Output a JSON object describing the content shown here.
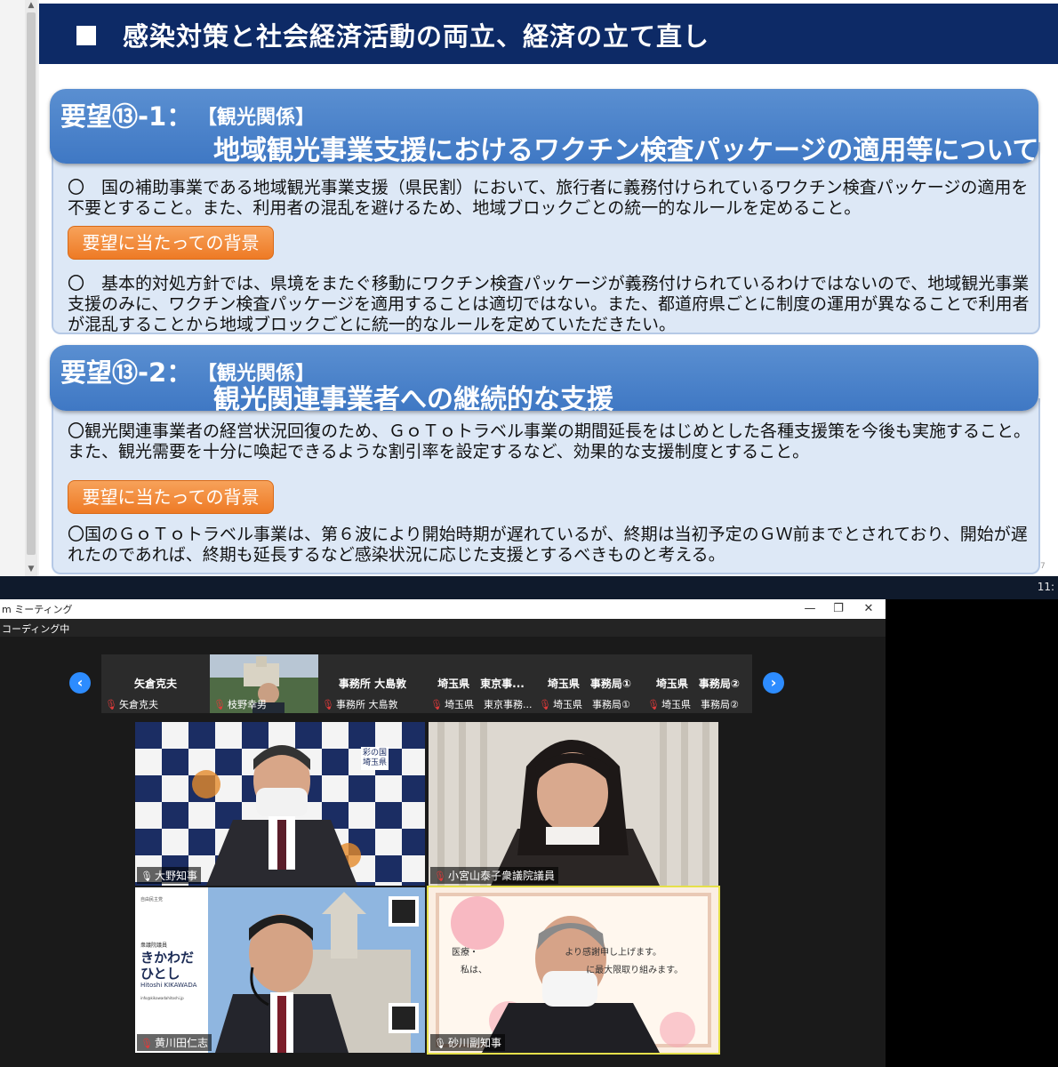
{
  "slide": {
    "header_title": "感染対策と社会経済活動の両立、経済の立て直し",
    "request1": {
      "number": "要望⑬-1：",
      "category": "【観光関係】",
      "title": "地域観光事業支援におけるワクチン検査パッケージの適用等について",
      "body_line1": "〇　国の補助事業である地域観光事業支援（県民割）において、旅行者に義務付けられているワクチン検査パッケージの適用を",
      "body_line2": "不要とすること。また、利用者の混乱を避けるため、地域ブロックごとの統一的なルールを定めること。",
      "background_button": "要望に当たっての背景",
      "bg_line1": "〇　基本的対処方針では、県境をまたぐ移動にワクチン検査パッケージが義務付けられているわけではないので、地域観光事業",
      "bg_line2": "支援のみに、ワクチン検査パッケージを適用することは適切ではない。また、都道府県ごとに制度の運用が異なることで利用者",
      "bg_line3": "が混乱することから地域ブロックごとに統一的なルールを定めていただきたい。"
    },
    "request2": {
      "number": "要望⑬-2：",
      "category": "【観光関係】",
      "title": "観光関連事業者への継続的な支援",
      "body_line1": "〇観光関連事業者の経営状況回復のため、ＧｏＴｏトラベル事業の期間延長をはじめとした各種支援策を今後も実施すること。",
      "body_line2": "また、観光需要を十分に喚起できるような割引率を設定するなど、効果的な支援制度とすること。",
      "background_button": "要望に当たっての背景",
      "bg_line1": "〇国のＧｏＴｏトラベル事業は、第６波により開始時期が遅れているが、終期は当初予定のＧＷ前までとされており、開始が遅",
      "bg_line2": "れたのであれば、終期も延長するなど感染状況に応じた支援とするべきものと考える。"
    },
    "page_number": "7"
  },
  "taskbar": {
    "clock": "11:"
  },
  "zoom": {
    "window_title": "m ミーティング",
    "status": "コーディング中",
    "thumbnails": [
      {
        "name": "矢倉克夫",
        "label": "矢倉克夫"
      },
      {
        "name": "",
        "label": "枝野幸男"
      },
      {
        "name": "事務所 大島敦",
        "label": "事務所 大島敦"
      },
      {
        "name": "埼玉県　東京事...",
        "label": "埼玉県　東京事務..."
      },
      {
        "name": "埼玉県　事務局①",
        "label": "埼玉県　事務局①"
      },
      {
        "name": "埼玉県　事務局②",
        "label": "埼玉県　事務局②"
      }
    ],
    "videos": [
      {
        "label": "大野知事"
      },
      {
        "label": "小宮山泰子衆議院議員"
      },
      {
        "label": "黄川田仁志"
      },
      {
        "label": "砂川副知事"
      }
    ],
    "kikawada_card": {
      "party": "自由民主党",
      "role": "衆議院議員",
      "name_line1": "きかわだ",
      "name_line2": "ひとし",
      "roman": "Hitoshi KIKAWADA",
      "email": "info@kikawadahitoshi.jp"
    },
    "saitama_logo": {
      "line1": "彩の国",
      "line2": "埼玉県"
    },
    "sunagawa_bg": {
      "line1": "医療・",
      "line1b": "より感謝申し上げます。",
      "line2": "私は、",
      "line2b": "に最大限取り組みます。"
    }
  },
  "colors": {
    "header_navy": "#0d2a66",
    "request_blue": "#4a83cb",
    "button_orange": "#ee7a25",
    "zoom_accent": "#2d8cff",
    "active_speaker": "#e5e04a"
  }
}
